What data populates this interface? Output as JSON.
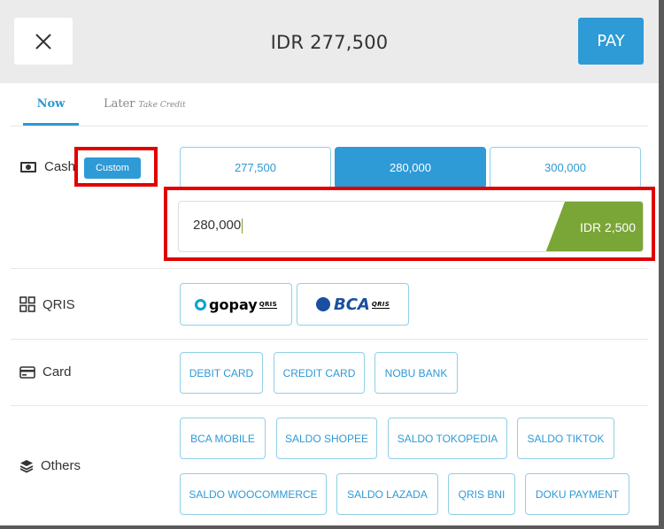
{
  "header": {
    "title": "IDR 277,500",
    "pay_label": "PAY"
  },
  "tabs": {
    "now": "Now",
    "later": "Later",
    "later_sub": "Take Credit"
  },
  "cash": {
    "label": "Cash",
    "custom_label": "Custom",
    "amounts": [
      "277,500",
      "280,000",
      "300,000"
    ],
    "selected": "280,000",
    "input_value": "280,000",
    "change": "IDR 2,500"
  },
  "qris": {
    "label": "QRIS",
    "options": [
      {
        "brand": "gopay",
        "qris": "QRIS"
      },
      {
        "brand": "BCA",
        "qris": "QRIS"
      }
    ]
  },
  "card": {
    "label": "Card",
    "options": [
      "DEBIT CARD",
      "CREDIT CARD",
      "NOBU BANK"
    ]
  },
  "others": {
    "label": "Others",
    "row1": [
      "BCA MOBILE",
      "SALDO SHOPEE",
      "SALDO TOKOPEDIA",
      "SALDO TIKTOK"
    ],
    "row2": [
      "SALDO WOOCOMMERCE",
      "SALDO LAZADA",
      "QRIS BNI",
      "DOKU PAYMENT"
    ]
  },
  "icons": {
    "close": "close-icon",
    "cash": "cash-icon",
    "qris": "grid-icon",
    "card": "card-icon",
    "others": "layers-icon"
  },
  "colors": {
    "accent": "#2e9ad6",
    "change_tag": "#7aa537",
    "highlight": "#e00000"
  }
}
